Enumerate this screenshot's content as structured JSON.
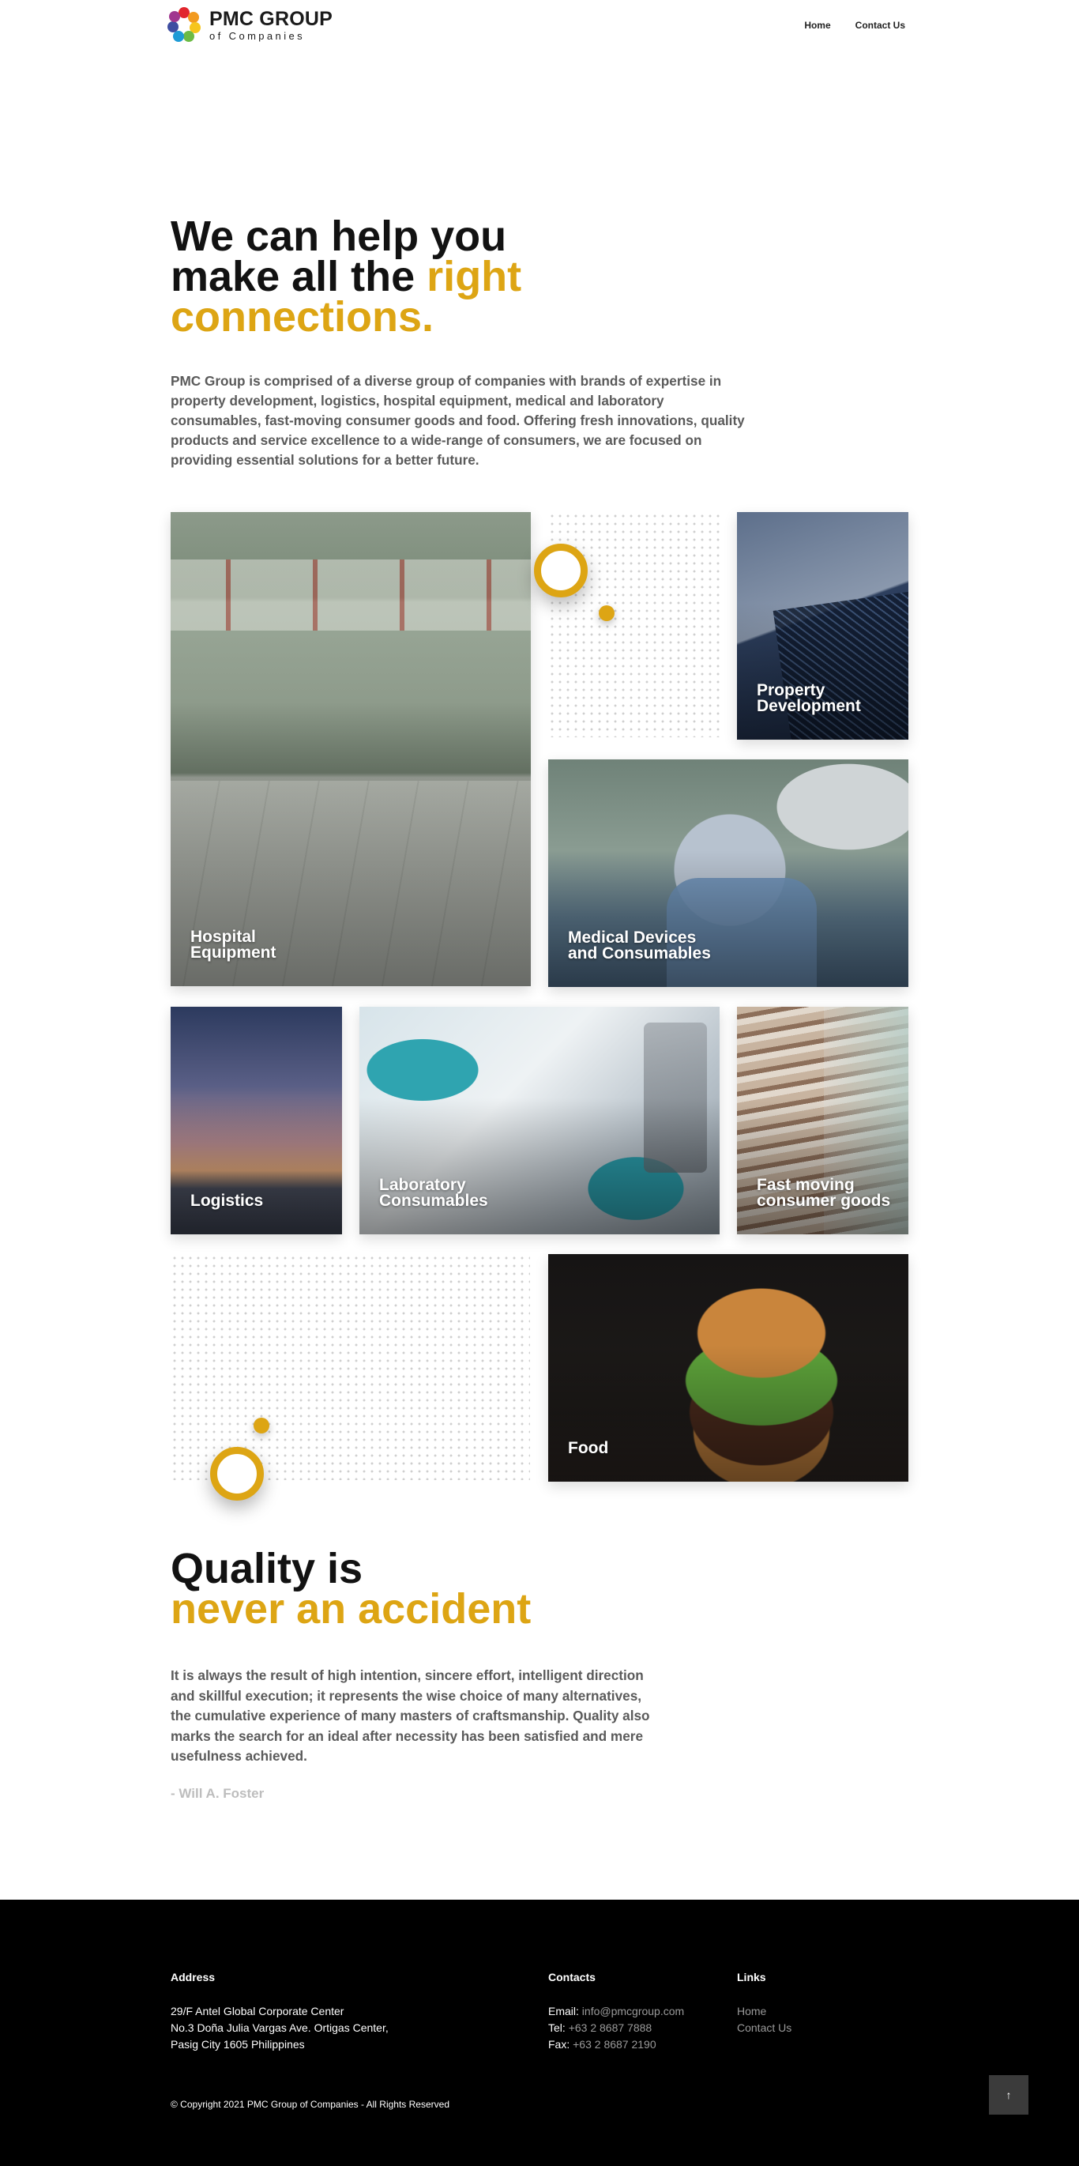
{
  "header": {
    "logo_title": "PMC GROUP",
    "logo_subtitle": "of Companies",
    "nav": {
      "home": "Home",
      "contact": "Contact Us"
    }
  },
  "hero": {
    "title_line1": "We can help you",
    "title_line2_plain": "make all the ",
    "title_line2_accent": "right",
    "title_line3_accent": "connections.",
    "description": "PMC Group is comprised of a diverse group of companies with brands of expertise in property development, logistics, hospital equipment, medical and laboratory consumables, fast-moving consumer goods and food. Offering fresh innovations, quality products and service excellence to a wide-range of consumers, we are focused on providing essential solutions for a better future."
  },
  "tiles": {
    "hospital": {
      "line1": "Hospital",
      "line2": "Equipment"
    },
    "property": {
      "line1": "Property",
      "line2": "Development"
    },
    "medical": {
      "line1": "Medical Devices",
      "line2": "and Consumables"
    },
    "logistics": {
      "line1": "Logistics"
    },
    "laboratory": {
      "line1": "Laboratory",
      "line2": "Consumables"
    },
    "fmcg": {
      "line1": "Fast moving",
      "line2": "consumer goods"
    },
    "food": {
      "line1": "Food"
    }
  },
  "quote": {
    "title_line1": "Quality is",
    "title_line2_accent": "never an accident",
    "text": "It is always the result of high intention, sincere effort, intelligent direction and skillful execution; it represents the wise choice of many alternatives, the cumulative experience of many masters of craftsmanship. Quality also marks the search for an ideal after necessity has been satisfied and mere usefulness achieved.",
    "author": "- Will A. Foster"
  },
  "footer": {
    "address": {
      "heading": "Address",
      "line1": "29/F Antel Global Corporate Center",
      "line2": "No.3 Doña Julia Vargas Ave. Ortigas Center,",
      "line3": "Pasig City 1605 Philippines"
    },
    "contacts": {
      "heading": "Contacts",
      "email_label": "Email:",
      "email": "info@pmcgroup.com",
      "tel_label": "Tel:",
      "tel": "+63 2 8687 7888",
      "fax_label": "Fax:",
      "fax": "+63 2 8687 2190"
    },
    "links": {
      "heading": "Links",
      "home": "Home",
      "contact": "Contact Us"
    },
    "copyright": "© Copyright 2021 PMC Group of Companies - All Rights Reserved",
    "to_top": "↑"
  },
  "colors": {
    "accent": "#dda514",
    "footer_bg": "#000000",
    "body_text": "#5a5a5a"
  }
}
